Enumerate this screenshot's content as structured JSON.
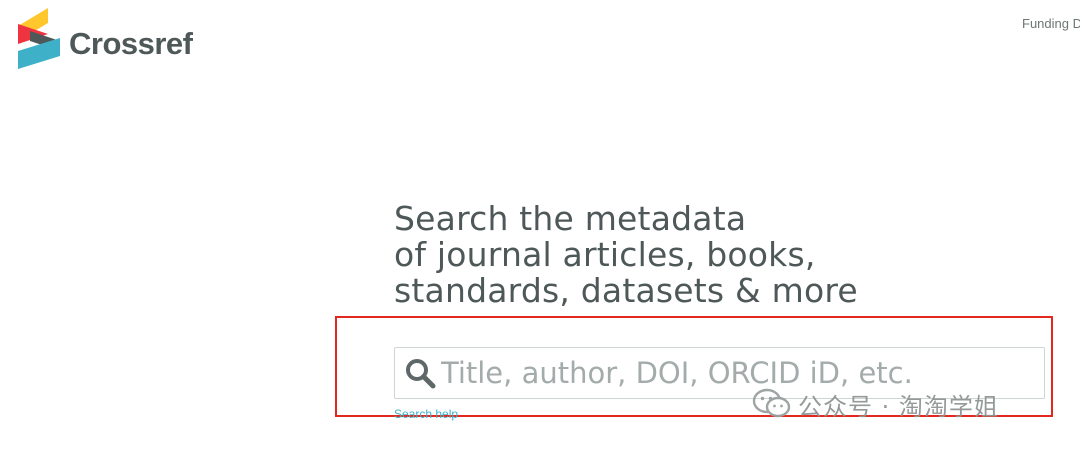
{
  "header": {
    "logo_text": "Crossref",
    "top_link": "Funding D"
  },
  "main": {
    "headline_lines": [
      "Search the metadata",
      "of journal articles, books,",
      "standards, datasets & more"
    ],
    "search": {
      "placeholder": "Title, author, DOI, ORCID iD, etc.",
      "value": ""
    },
    "search_help": "Search help"
  },
  "watermark": {
    "text": "公众号 · 淘淘学姐"
  },
  "colors": {
    "highlight_border": "#e3291f",
    "logo_red": "#ef3340",
    "logo_yellow": "#ffc72c",
    "logo_gray": "#4f5858",
    "logo_cyan": "#3eb1c8",
    "help_link": "#3eb1c8"
  },
  "icons": [
    "crossref-logo-icon",
    "search-icon",
    "wechat-icon"
  ]
}
